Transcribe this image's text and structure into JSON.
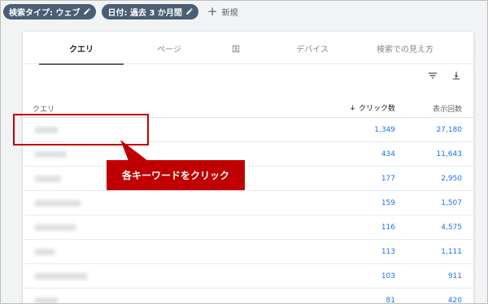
{
  "filters": {
    "chips": [
      {
        "label": "検索タイプ: ウェブ"
      },
      {
        "label": "日付: 過去 3 か月間"
      }
    ],
    "new_label": "新規"
  },
  "tabs": [
    {
      "label": "クエリ",
      "active": true
    },
    {
      "label": "ページ",
      "active": false
    },
    {
      "label": "国",
      "active": false
    },
    {
      "label": "デバイス",
      "active": false
    },
    {
      "label": "検索での見え方",
      "active": false
    }
  ],
  "toolbar": {
    "filter_icon": "filter-icon",
    "download_icon": "download-icon"
  },
  "table": {
    "headers": {
      "query": "クエリ",
      "clicks": "クリック数",
      "impressions": "表示回数"
    },
    "sort_icon": "arrow-down-icon",
    "rows": [
      {
        "clicks": "1,349",
        "impressions": "27,180"
      },
      {
        "clicks": "434",
        "impressions": "11,643"
      },
      {
        "clicks": "177",
        "impressions": "2,950"
      },
      {
        "clicks": "159",
        "impressions": "1,507"
      },
      {
        "clicks": "116",
        "impressions": "4,575"
      },
      {
        "clicks": "113",
        "impressions": "1,111"
      },
      {
        "clicks": "103",
        "impressions": "911"
      },
      {
        "clicks": "81",
        "impressions": "420"
      }
    ]
  },
  "annotation": {
    "callout": "各キーワードをクリック",
    "color": "#c00000"
  },
  "colors": {
    "accent": "#1a73e8",
    "chip": "#4a5e74"
  }
}
